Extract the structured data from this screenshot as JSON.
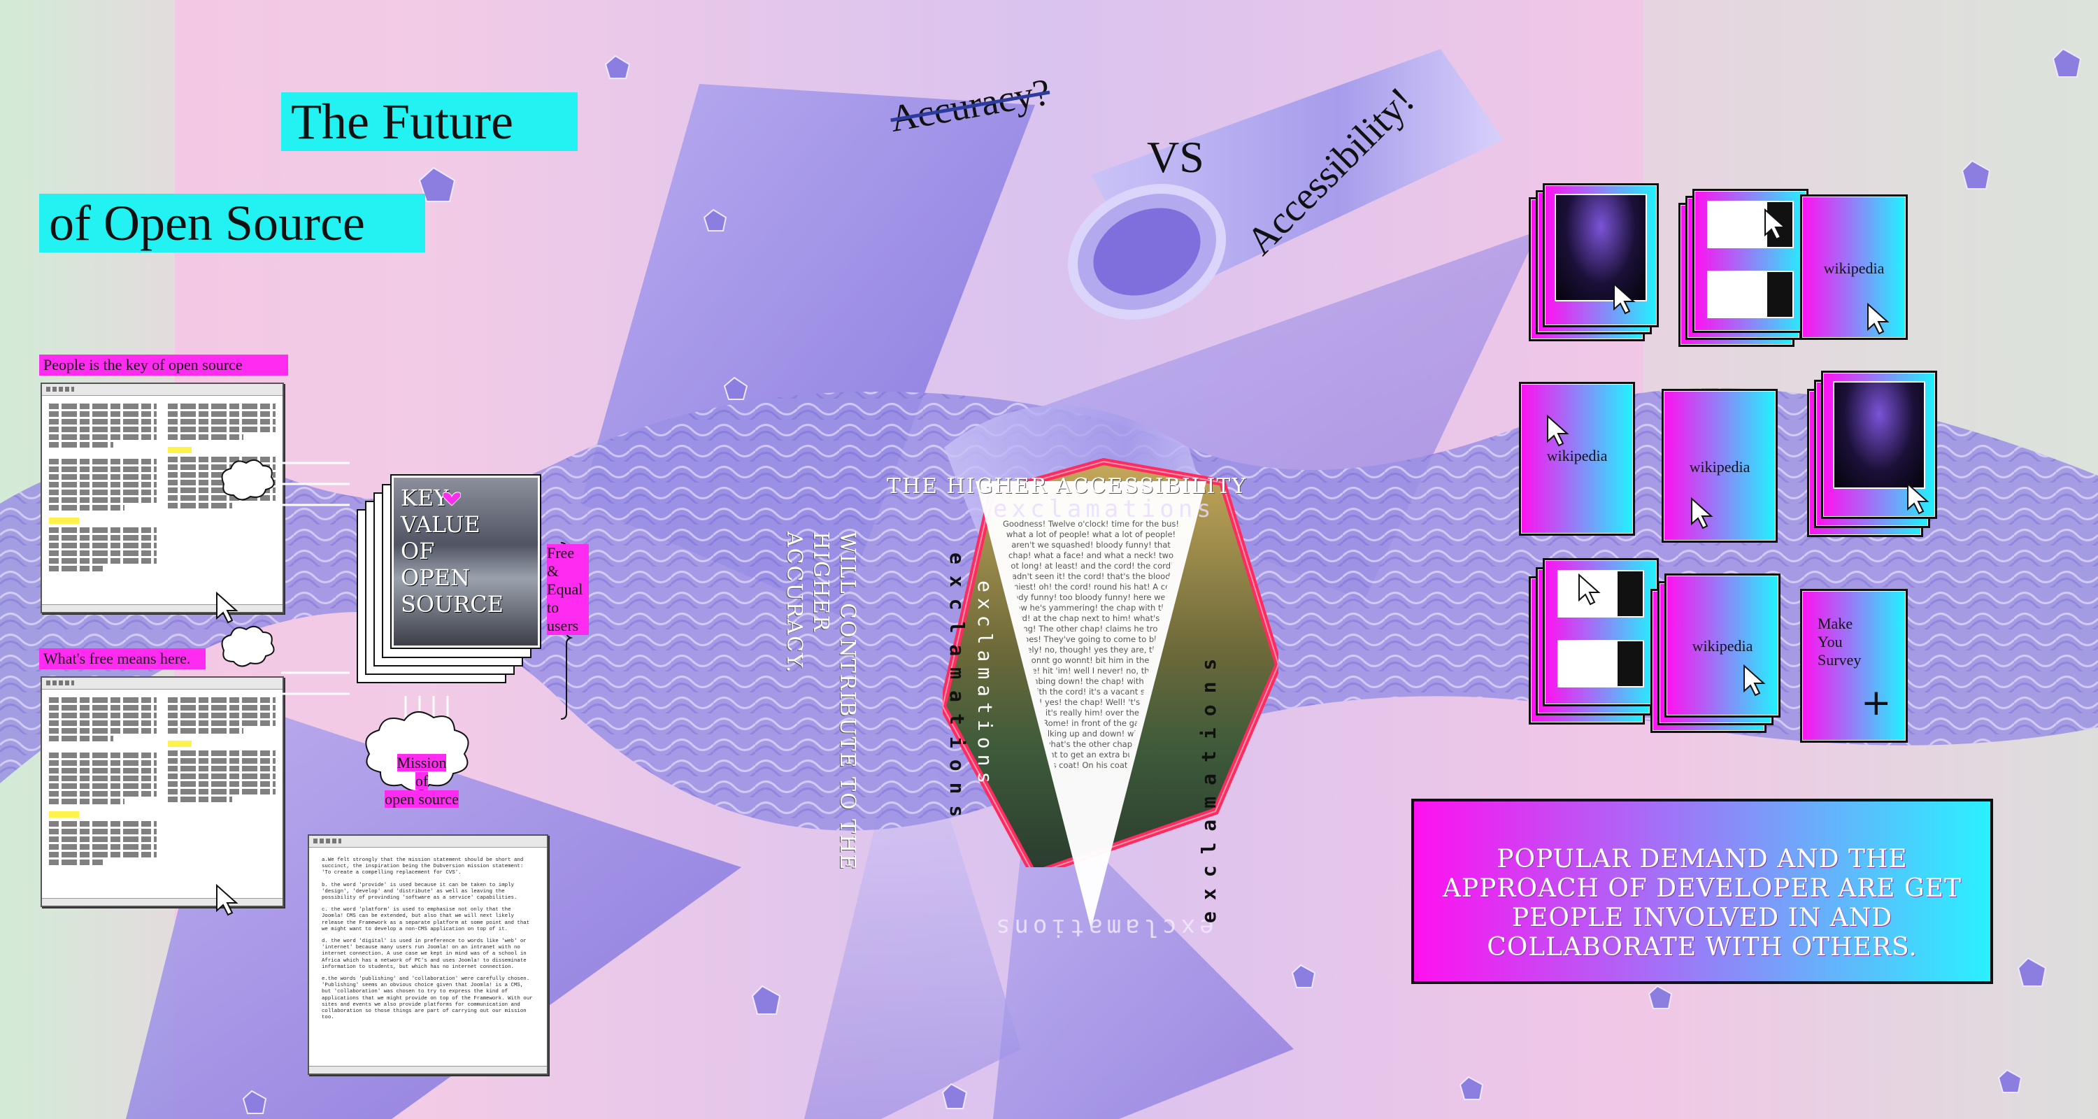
{
  "title": {
    "line1": "The Future",
    "line2": "of Open Source"
  },
  "left": {
    "label1": "People is the key of open source",
    "label2": "What's free means here.",
    "key_value": [
      "KEY",
      "VALUE",
      "OF",
      "OPEN",
      "SOURCE"
    ],
    "free_equal": [
      "Free",
      "&",
      "Equal",
      "to",
      "users"
    ],
    "mission": [
      "Mission",
      "of",
      "open source"
    ],
    "doc_paragraphs": [
      "a.We felt strongly that the mission statement should be short and succinct, the inspiration being the Dubversion mission statement: 'To create a compelling replacement for CVS'.",
      "b. the word 'provide' is used because it can be taken to imply 'design', 'develop' and 'distribute' as well as leaving   the possibility of provinding 'software as a service' capabilities.",
      "c. the word 'platform' is used to emphasise not only that the Joomla! CMS can be extended, but also that we will next likely release the Framework as a separate platform at some point and that we might want to develop a non-CMS application on top of it.",
      "d. the word 'digital' is used in preference to words like 'web' or 'internet' because many users run Joomla! on an intranet with no internet connection. A use case we kept in mind was of a school in Africa which has a network of PC's and uses Joomla! to disseminate information to students, but which has no internet connection.",
      "e.the words 'publishing' and 'collaboration' were carefully chosen. 'Publishing' seems an obvious choice given that Joomla! is a CMS, but 'collaboration' was chosen to try to express the kind of applications that we might provide on top of the Framework. With our sites and events we also provide platforms for communication and collaboration so those things are part of carrying out our mission too."
    ]
  },
  "center": {
    "accuracy": "Accuracy?",
    "vs": "VS",
    "accessibility": "Accessibility!",
    "higher_line1": "THE HIGHER ACCESSIBILITY",
    "higher_line2": "WILL CONTRIBUTE TO THE HIGHER",
    "higher_line3": "ACCURACY.",
    "exclamations": "exclamations",
    "v_text": "Goodness! Twelve o'clock! time for the bus! what a lot of people! what a lot of people! aren't we squashed! bloody funny! that chap! what a face! and what a neck! two foot long! at least! and the cord! the cord! I hadn't seen it! the cord! that's the bloody funniest! oh! the cord! round his hat! A cord! bloody funny! too bloody funny! here we go, now he's yammering! the chap with the cord! at the chap next to him! what's he saying! The other chap! claims he trod on his toes! They've going to come to blows! definitely! no, though! yes they are, though! go wonnt go wonnt! bit him in the eye! charge! hit 'im! well I never! no, though! he's climbing down! the chap! with the long neck! with the cord! it's a vacant seat he's charging! yes! the chap! Well! 't's true! no! I'm right! it's really him! over there! in the Cour de Rome! in front of the gare Saint-Lazare! walking up and down! with another chap! and what's the other chap telling him! that he ought to get an extra button! yes! a button on his coat! On his coat! Good ness!"
  },
  "right": {
    "wikipedia": "wikipedia",
    "survey": [
      "Make",
      "You",
      "Survey"
    ],
    "plus": "+",
    "popular": "POPULAR DEMAND AND THE APPROACH OF DEVELOPER ARE GET PEOPLE INVOLVED IN AND COLLABORATE WITH OTHERS."
  },
  "colors": {
    "cyan": "#22f2f2",
    "magenta": "#ff2bf0",
    "lavender": "#8f86e6"
  }
}
